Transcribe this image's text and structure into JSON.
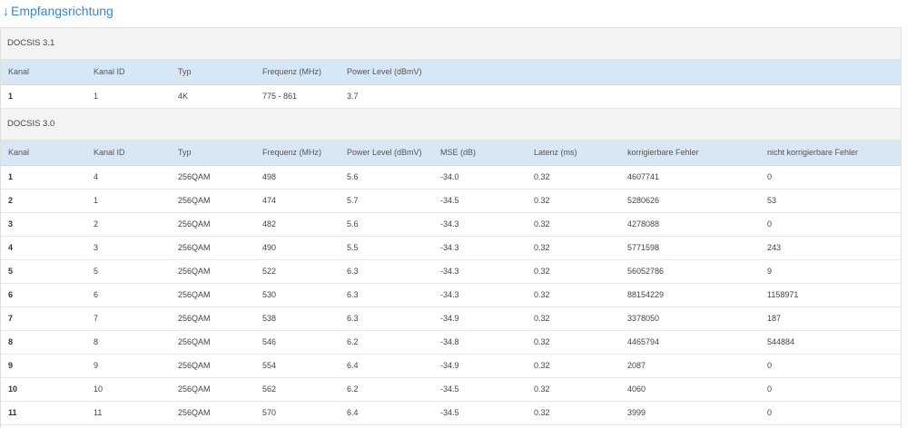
{
  "section": {
    "arrow": "↓",
    "title": "Empfangsrichtung"
  },
  "docsis31": {
    "label": "DOCSIS 3.1",
    "columns": [
      "Kanal",
      "Kanal ID",
      "Typ",
      "Frequenz (MHz)",
      "Power Level (dBmV)"
    ],
    "rows": [
      [
        "1",
        "1",
        "4K",
        "775 - 861",
        "3.7"
      ]
    ]
  },
  "docsis30": {
    "label": "DOCSIS 3.0",
    "columns": [
      "Kanal",
      "Kanal ID",
      "Typ",
      "Frequenz (MHz)",
      "Power Level (dBmV)",
      "MSE (dB)",
      "Latenz (ms)",
      "korrigierbare Fehler",
      "nicht korrigierbare Fehler"
    ],
    "rows": [
      [
        "1",
        "4",
        "256QAM",
        "498",
        "5.6",
        "-34.0",
        "0.32",
        "4607741",
        "0"
      ],
      [
        "2",
        "1",
        "256QAM",
        "474",
        "5.7",
        "-34.5",
        "0.32",
        "5280626",
        "53"
      ],
      [
        "3",
        "2",
        "256QAM",
        "482",
        "5.6",
        "-34.3",
        "0.32",
        "4278088",
        "0"
      ],
      [
        "4",
        "3",
        "256QAM",
        "490",
        "5.5",
        "-34.3",
        "0.32",
        "5771598",
        "243"
      ],
      [
        "5",
        "5",
        "256QAM",
        "522",
        "6.3",
        "-34.3",
        "0.32",
        "56052786",
        "9"
      ],
      [
        "6",
        "6",
        "256QAM",
        "530",
        "6.3",
        "-34.3",
        "0.32",
        "88154229",
        "1158971"
      ],
      [
        "7",
        "7",
        "256QAM",
        "538",
        "6.3",
        "-34.9",
        "0.32",
        "3378050",
        "187"
      ],
      [
        "8",
        "8",
        "256QAM",
        "546",
        "6.2",
        "-34.8",
        "0.32",
        "4465794",
        "544884"
      ],
      [
        "9",
        "9",
        "256QAM",
        "554",
        "6.4",
        "-34.9",
        "0.32",
        "2087",
        "0"
      ],
      [
        "10",
        "10",
        "256QAM",
        "562",
        "6.2",
        "-34.5",
        "0.32",
        "4060",
        "0"
      ],
      [
        "11",
        "11",
        "256QAM",
        "570",
        "6.4",
        "-34.5",
        "0.32",
        "3999",
        "0"
      ]
    ]
  }
}
